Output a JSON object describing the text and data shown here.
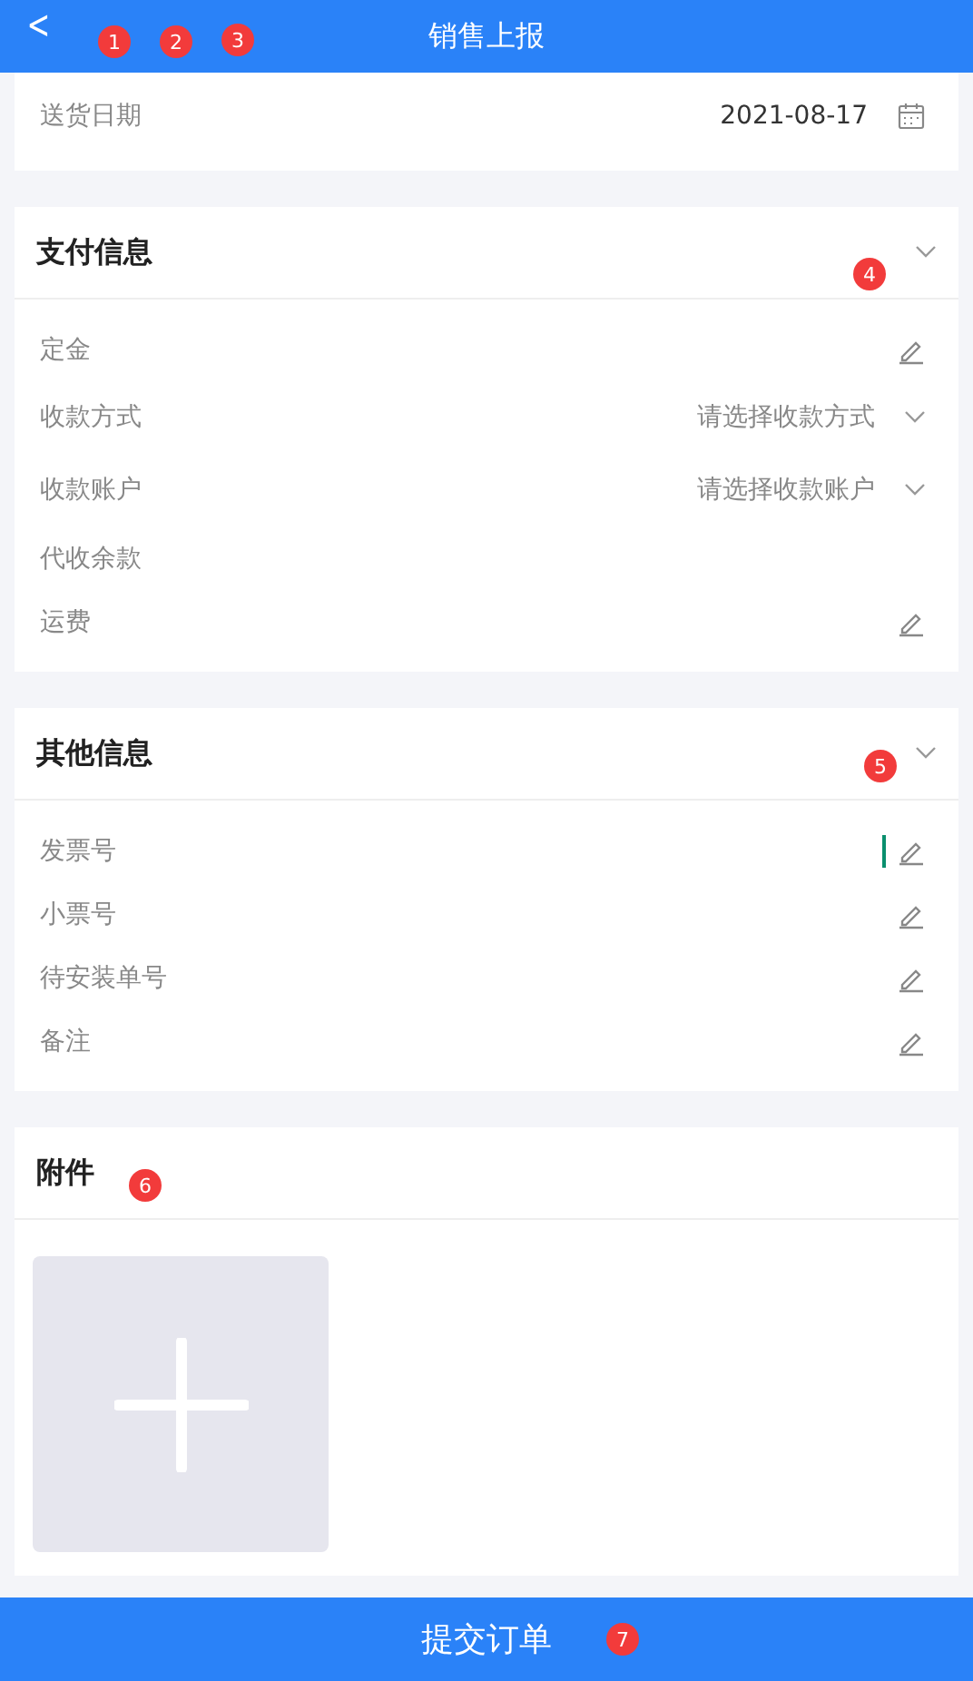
{
  "header": {
    "title": "销售上报",
    "back": "<"
  },
  "delivery": {
    "label": "送货日期",
    "value": "2021-08-17"
  },
  "sections": [
    {
      "title": "支付信息",
      "rows": [
        {
          "label": "定金",
          "kind": "edit",
          "focused": false
        },
        {
          "label": "收款方式",
          "kind": "select",
          "placeholder": "请选择收款方式",
          "focused": false
        },
        {
          "label": "收款账户",
          "kind": "select",
          "placeholder": "请选择收款账户",
          "focused": false
        },
        {
          "label": "代收余款",
          "kind": "text",
          "focused": false
        },
        {
          "label": "运费",
          "kind": "edit",
          "focused": false
        }
      ]
    },
    {
      "title": "其他信息",
      "rows": [
        {
          "label": "发票号",
          "kind": "edit",
          "focused": true
        },
        {
          "label": "小票号",
          "kind": "edit",
          "focused": false
        },
        {
          "label": "待安装单号",
          "kind": "edit",
          "focused": false
        },
        {
          "label": "备注",
          "kind": "edit",
          "focused": false
        }
      ]
    }
  ],
  "attachments": {
    "title": "附件"
  },
  "submit": {
    "label": "提交订单"
  },
  "markers": [
    {
      "label": "1"
    },
    {
      "label": "2"
    },
    {
      "label": "3"
    },
    {
      "label": "4"
    },
    {
      "label": "5"
    },
    {
      "label": "6"
    },
    {
      "label": "7"
    }
  ]
}
